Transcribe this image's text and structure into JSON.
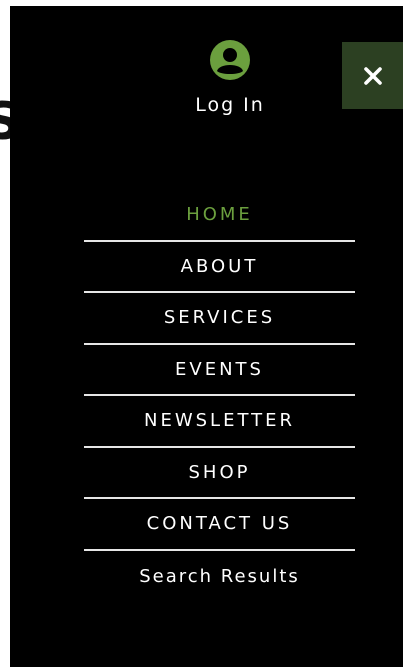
{
  "menu": {
    "login_label": "Log In",
    "items": [
      {
        "label": "HOME",
        "active": true
      },
      {
        "label": "ABOUT"
      },
      {
        "label": "SERVICES"
      },
      {
        "label": "EVENTS"
      },
      {
        "label": "NEWSLETTER"
      },
      {
        "label": "SHOP"
      },
      {
        "label": "CONTACT US"
      },
      {
        "label": "Search Results"
      }
    ]
  },
  "icons": {
    "close": "close-icon",
    "avatar": "user-avatar-icon"
  },
  "colors": {
    "drawer_bg": "#000000",
    "accent_green": "#6b9f3e",
    "close_bg": "#2c4022",
    "text": "#ffffff",
    "divider": "#e6e6e6"
  }
}
